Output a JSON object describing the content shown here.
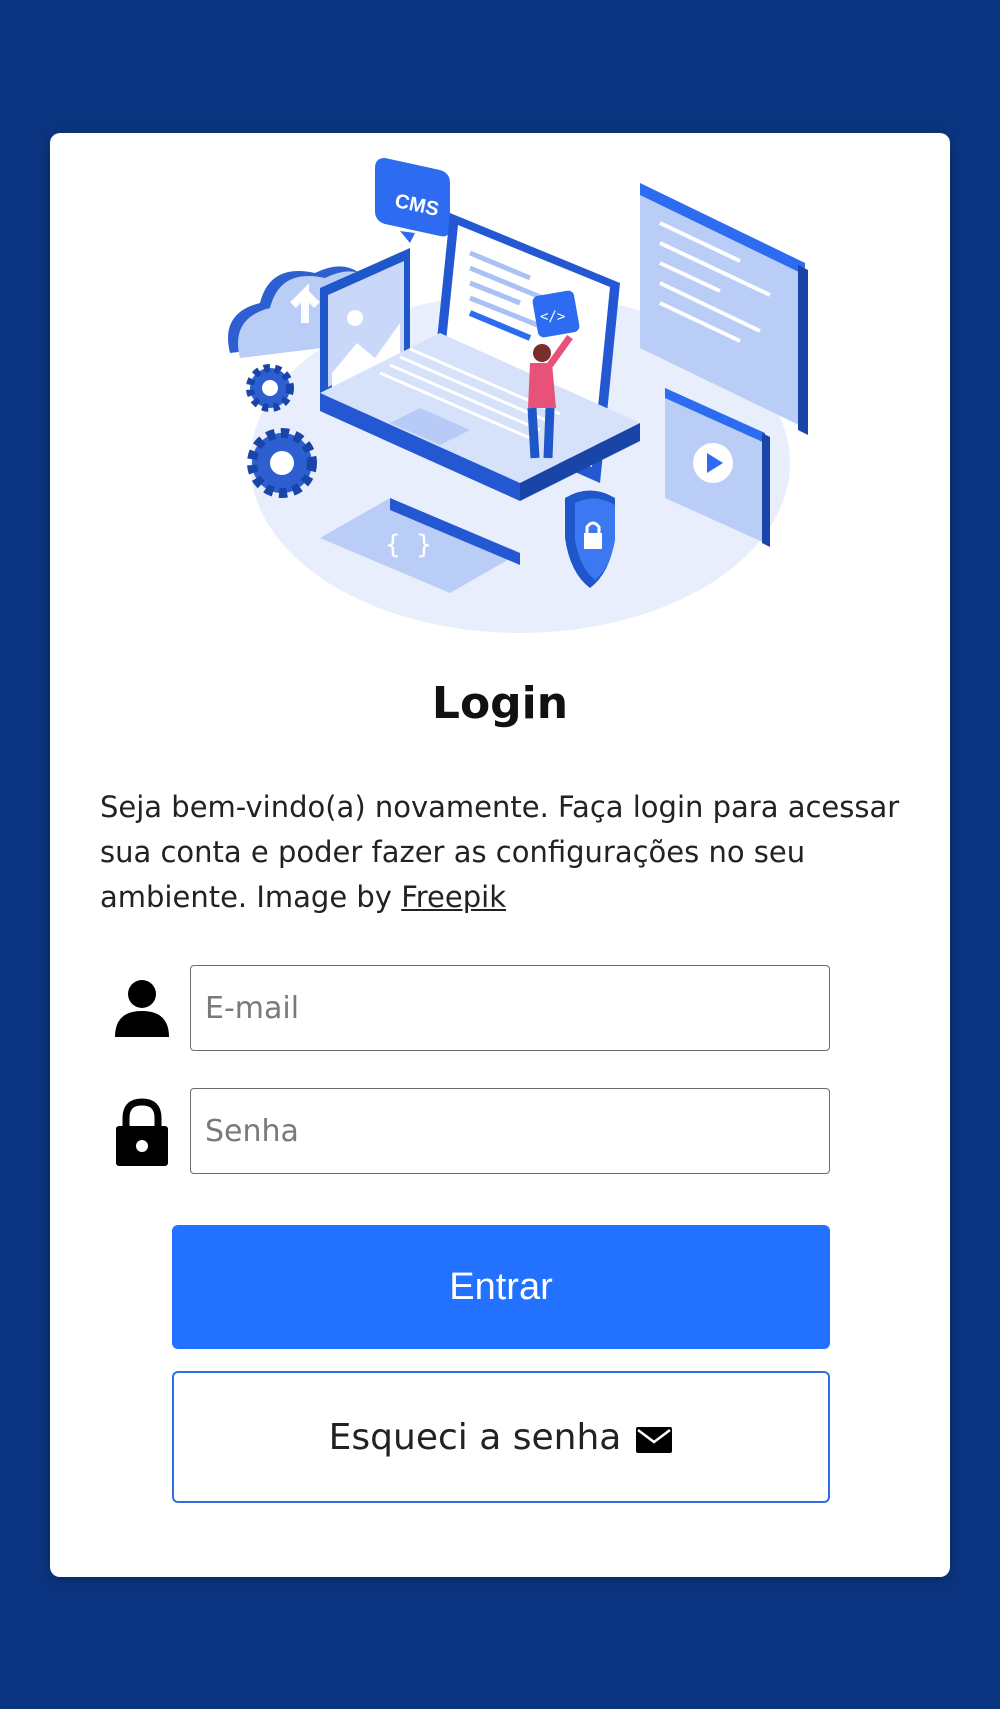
{
  "login": {
    "title": "Login",
    "intro_text": "Seja bem-vindo(a) novamente. Faça login para acessar sua conta e poder fazer as configurações no seu ambiente. Image by ",
    "credit_link": "Freepik",
    "email_placeholder": "E-mail",
    "password_placeholder": "Senha",
    "submit_label": "Entrar",
    "forgot_label": "Esqueci a senha",
    "illustration_badge": "CMS",
    "illustration_code": "</>"
  },
  "icons": {
    "email_field": "person-icon",
    "password_field": "lock-icon",
    "forgot_button": "mail-icon"
  },
  "colors": {
    "background": "#0b3580",
    "card": "#ffffff",
    "primary": "#2271ff",
    "secondary_border": "#2f6fe6"
  }
}
